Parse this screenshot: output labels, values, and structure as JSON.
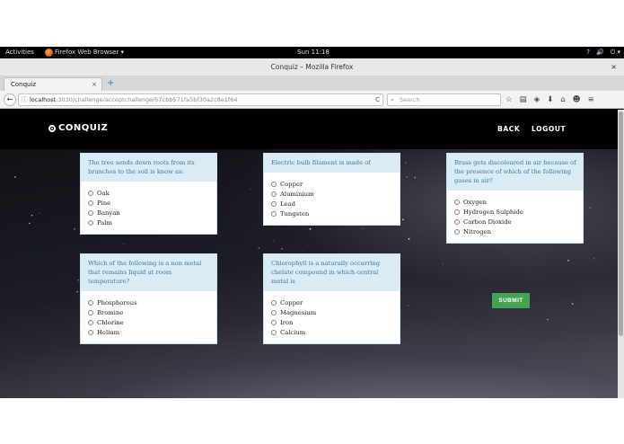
{
  "topbar": {
    "activities": "Activities",
    "app_menu": "Firefox Web Browser ▾",
    "clock": "Sun 11:18",
    "tray_icons": [
      "?",
      "🔊",
      "⏻ ▾"
    ]
  },
  "window": {
    "title": "Conquiz – Mozilla Firefox",
    "close": "×"
  },
  "tabs": {
    "active_label": "Conquiz",
    "close": "×",
    "new_tab": "+"
  },
  "nav": {
    "back": "←",
    "info": "ⓘ",
    "url_host": "localhost",
    "url_path": ":3030/challenge/acceptchallenge/57cbb571fa5bf30a2c8e1f64",
    "reload": "C",
    "search_icon": "⌕",
    "search_placeholder": "Search",
    "toolbar_icons": [
      "☆",
      "▤",
      "◈",
      "⬇",
      "⌂",
      "☻",
      "≡"
    ]
  },
  "site": {
    "logo": "CONQUIZ",
    "back_link": "BACK",
    "logout_link": "LOGOUT",
    "submit": "SUBMIT"
  },
  "questions": [
    {
      "question": "The tree sends down roots from its branches to the soil is know as:",
      "options": [
        "Oak",
        "Pine",
        "Banyan",
        "Palm"
      ]
    },
    {
      "question": "Electric bulb filament is made of",
      "options": [
        "Copper",
        "Aluminium",
        "Lead",
        "Tungsten"
      ]
    },
    {
      "question": "Brass gets discoloured in air because of the presence of which of the following gases in air?",
      "options": [
        "Oxygen",
        "Hydrogen Sulphide",
        "Carbon Dioxide",
        "Nitrogen"
      ]
    },
    {
      "question": "Which of the following is a non metal that remains liquid at room temperature?",
      "options": [
        "Phosphorous",
        "Bromine",
        "Chlorine",
        "Helium"
      ]
    },
    {
      "question": "Chlorophyll is a naturally occurring chelate compound in which central metal is",
      "options": [
        "Copper",
        "Magnesium",
        "Iron",
        "Calcium"
      ]
    }
  ],
  "colors": {
    "accent_green": "#43a352",
    "question_bg": "#d9ecf6",
    "question_text": "#3c7a9a"
  }
}
